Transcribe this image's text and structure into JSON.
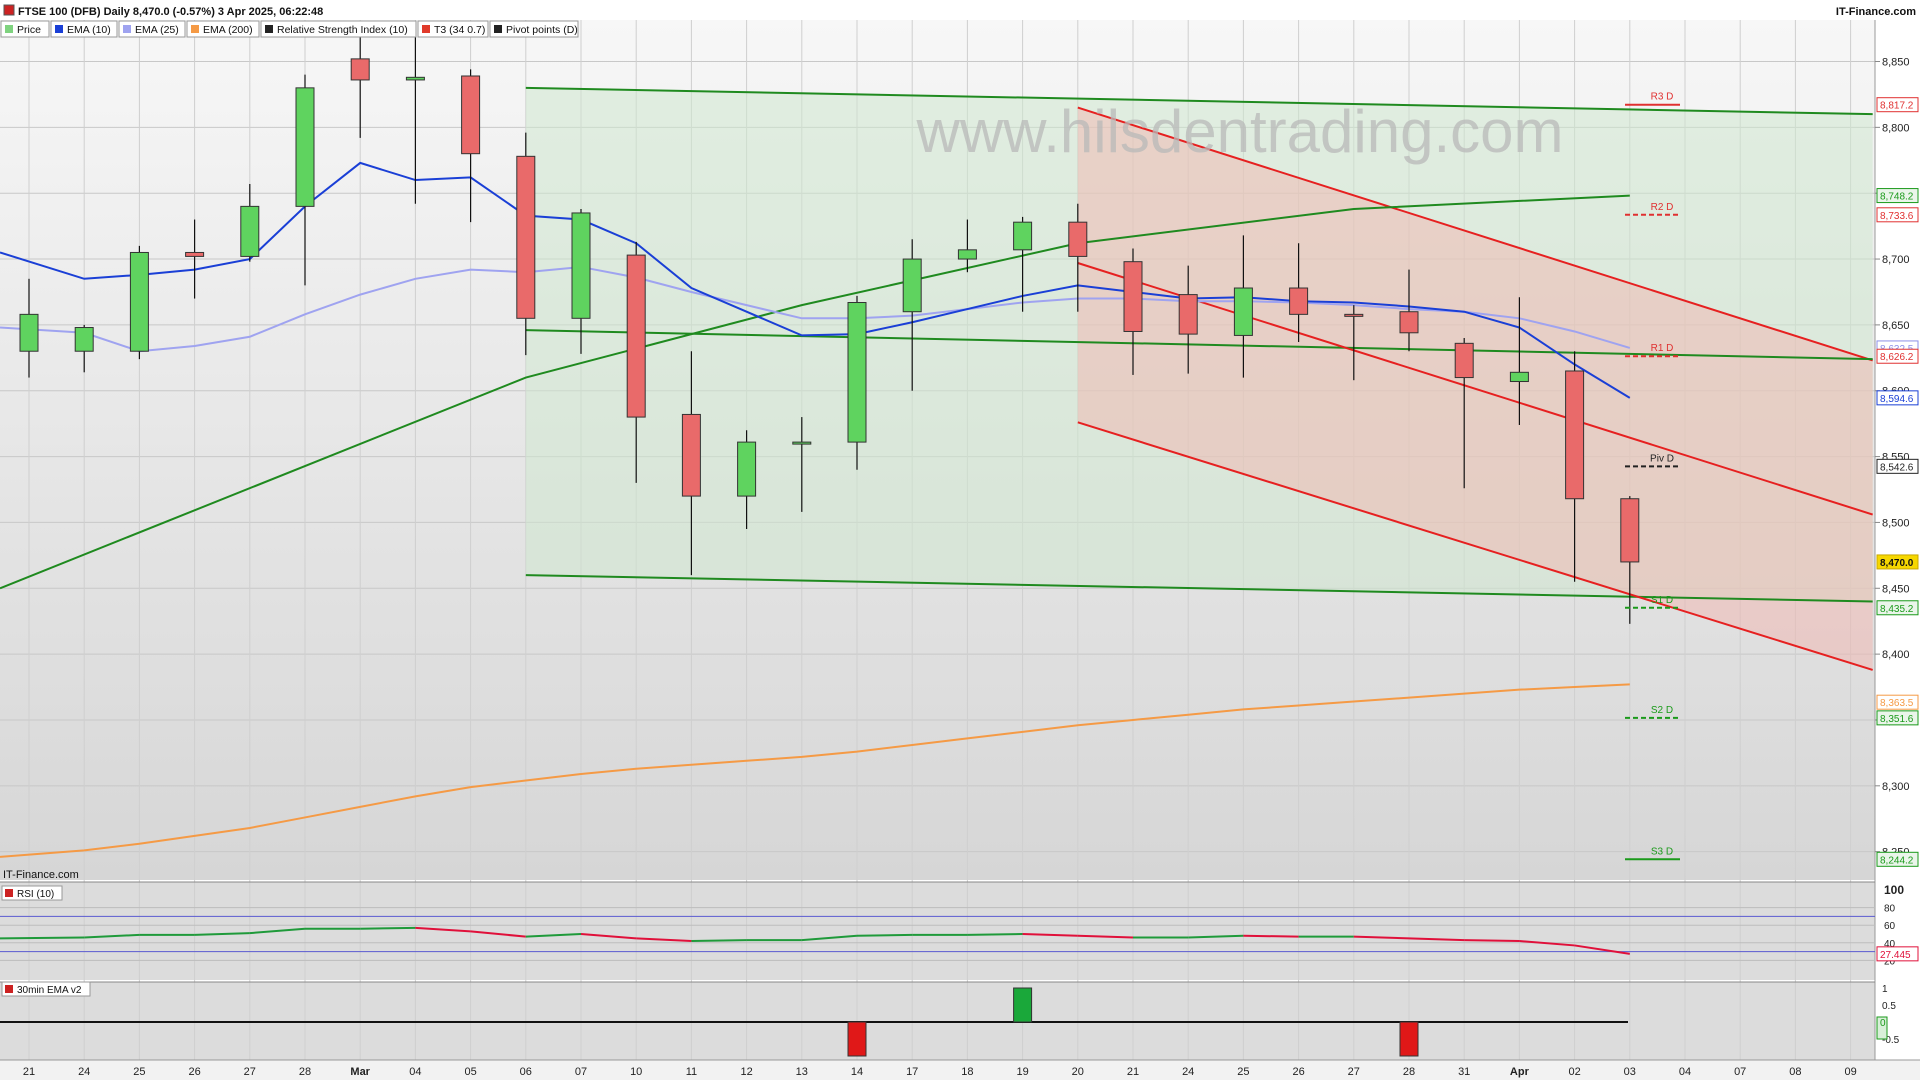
{
  "header": {
    "title": "FTSE 100 (DFB) Daily 8,470.0 (-0.57%) 3 Apr 2025, 06:22:48",
    "brand": "IT-Finance.com",
    "watermark": "www.hilsdentrading.com",
    "footer_brand": "IT-Finance.com"
  },
  "legend": [
    {
      "label": "Price",
      "color": "#7fd37f"
    },
    {
      "label": "EMA (10)",
      "color": "#1a3fd6"
    },
    {
      "label": "EMA (25)",
      "color": "#9fa3f0"
    },
    {
      "label": "EMA (200)",
      "color": "#f59a45"
    },
    {
      "label": "Relative Strength Index (10)",
      "color": "#222222"
    },
    {
      "label": "T3 (34 0.7)",
      "color": "#e03a2a"
    },
    {
      "label": "Pivot points (D)",
      "color": "#222222"
    }
  ],
  "rsi_panel": {
    "label": "RSI (10)",
    "value_label": "27.445"
  },
  "ema30_panel": {
    "label": "30min EMA v2"
  },
  "chart_data": {
    "type": "candlestick",
    "x_labels": [
      "21",
      "24",
      "25",
      "26",
      "27",
      "28",
      "Mar",
      "04",
      "05",
      "06",
      "07",
      "10",
      "11",
      "12",
      "13",
      "14",
      "17",
      "18",
      "19",
      "20",
      "21",
      "24",
      "25",
      "26",
      "27",
      "28",
      "31",
      "Apr",
      "02",
      "03",
      "04",
      "07",
      "08",
      "09"
    ],
    "candles": [
      {
        "o": 8630,
        "h": 8685,
        "l": 8610,
        "c": 8658
      },
      {
        "o": 8630,
        "h": 8650,
        "l": 8614,
        "c": 8648
      },
      {
        "o": 8630,
        "h": 8710,
        "l": 8624,
        "c": 8705
      },
      {
        "o": 8705,
        "h": 8730,
        "l": 8670,
        "c": 8702
      },
      {
        "o": 8702,
        "h": 8757,
        "l": 8698,
        "c": 8740
      },
      {
        "o": 8740,
        "h": 8840,
        "l": 8680,
        "c": 8830
      },
      {
        "o": 8852,
        "h": 8876,
        "l": 8792,
        "c": 8836
      },
      {
        "o": 8836,
        "h": 8871,
        "l": 8742,
        "c": 8838
      },
      {
        "o": 8839,
        "h": 8844,
        "l": 8728,
        "c": 8780
      },
      {
        "o": 8778,
        "h": 8796,
        "l": 8627,
        "c": 8655
      },
      {
        "o": 8655,
        "h": 8738,
        "l": 8628,
        "c": 8735
      },
      {
        "o": 8703,
        "h": 8713,
        "l": 8530,
        "c": 8580
      },
      {
        "o": 8582,
        "h": 8630,
        "l": 8460,
        "c": 8520
      },
      {
        "o": 8520,
        "h": 8570,
        "l": 8495,
        "c": 8561
      },
      {
        "o": 8561,
        "h": 8580,
        "l": 8508,
        "c": 8561
      },
      {
        "o": 8561,
        "h": 8672,
        "l": 8540,
        "c": 8667
      },
      {
        "o": 8660,
        "h": 8715,
        "l": 8600,
        "c": 8700
      },
      {
        "o": 8700,
        "h": 8730,
        "l": 8690,
        "c": 8707
      },
      {
        "o": 8707,
        "h": 8732,
        "l": 8660,
        "c": 8728
      },
      {
        "o": 8728,
        "h": 8742,
        "l": 8660,
        "c": 8702
      },
      {
        "o": 8698,
        "h": 8708,
        "l": 8612,
        "c": 8645
      },
      {
        "o": 8673,
        "h": 8695,
        "l": 8613,
        "c": 8643
      },
      {
        "o": 8642,
        "h": 8718,
        "l": 8610,
        "c": 8678
      },
      {
        "o": 8678,
        "h": 8712,
        "l": 8637,
        "c": 8658
      },
      {
        "o": 8658,
        "h": 8665,
        "l": 8608,
        "c": 8657
      },
      {
        "o": 8660,
        "h": 8692,
        "l": 8630,
        "c": 8644
      },
      {
        "o": 8636,
        "h": 8640,
        "l": 8526,
        "c": 8610
      },
      {
        "o": 8607,
        "h": 8671,
        "l": 8574,
        "c": 8614
      },
      {
        "o": 8615,
        "h": 8630,
        "l": 8455,
        "c": 8518
      },
      {
        "o": 8518,
        "h": 8520,
        "l": 8423,
        "c": 8470
      }
    ],
    "ema10": [
      8705,
      8685,
      8688,
      8692,
      8700,
      8740,
      8773,
      8760,
      8762,
      8733,
      8730,
      8712,
      8678,
      8660,
      8642,
      8643,
      8652,
      8662,
      8672,
      8680,
      8675,
      8670,
      8671,
      8668,
      8667,
      8664,
      8660,
      8648,
      8620,
      8594.6
    ],
    "ema25": [
      8648,
      8644,
      8630,
      8634,
      8641,
      8658,
      8673,
      8685,
      8692,
      8690,
      8694,
      8686,
      8675,
      8665,
      8655,
      8655,
      8657,
      8662,
      8667,
      8670,
      8670,
      8668,
      8668,
      8667,
      8665,
      8662,
      8660,
      8655,
      8645,
      8632.5
    ],
    "ema200": [
      8246,
      8251,
      8256,
      8262,
      8268,
      8276,
      8284,
      8292,
      8299,
      8304,
      8309,
      8313,
      8316,
      8319,
      8322,
      8326,
      8331,
      8336,
      8341,
      8346,
      8350,
      8354,
      8358,
      8361,
      8364,
      8367,
      8370,
      8373,
      8375,
      8377
    ],
    "pivots": [
      {
        "label": "R3 D",
        "value": 8817.2,
        "color": "#e03030"
      },
      {
        "label": "R2 D",
        "value": 8733.6,
        "color": "#e03030"
      },
      {
        "label": "R1 D",
        "value": 8626.2,
        "color": "#e03030"
      },
      {
        "label": "Piv D",
        "value": 8542.6,
        "color": "#222222"
      },
      {
        "label": "S1 D",
        "value": 8435.2,
        "color": "#1a9a1a"
      },
      {
        "label": "S2 D",
        "value": 8351.6,
        "color": "#1a9a1a"
      },
      {
        "label": "S3 D",
        "value": 8244.2,
        "color": "#1a9a1a"
      }
    ],
    "y_ticks": [
      "8,850",
      "8,800",
      "8,750",
      "8,700",
      "8,650",
      "8,600",
      "8,550",
      "8,500",
      "8,450",
      "8,400",
      "8,350",
      "8,300",
      "8,250"
    ],
    "y_tick_values": [
      8850,
      8800,
      8750,
      8700,
      8650,
      8600,
      8550,
      8500,
      8450,
      8400,
      8350,
      8300,
      8250
    ],
    "ylim": [
      8230,
      8880
    ],
    "right_labels": [
      {
        "text": "8,817.2",
        "value": 8817.2,
        "bg": "#ffffff",
        "fg": "#e03030",
        "border": "#e03030"
      },
      {
        "text": "8,748.2",
        "value": 8748.2,
        "bg": "#eaf5ea",
        "fg": "#1a9a1a",
        "border": "#1a9a1a"
      },
      {
        "text": "8,733.6",
        "value": 8733.6,
        "bg": "#ffffff",
        "fg": "#e03030",
        "border": "#e03030"
      },
      {
        "text": "8,632.5",
        "value": 8632.5,
        "bg": "#ffffff",
        "fg": "#8b8fe8",
        "border": "#8b8fe8"
      },
      {
        "text": "8,626.2",
        "value": 8626.2,
        "bg": "#ffffff",
        "fg": "#e03030",
        "border": "#e03030"
      },
      {
        "text": "8,594.6",
        "value": 8594.6,
        "bg": "#ffffff",
        "fg": "#1a3fd6",
        "border": "#1a3fd6"
      },
      {
        "text": "8,542.6",
        "value": 8542.6,
        "bg": "#ffffff",
        "fg": "#222222",
        "border": "#222222"
      },
      {
        "text": "8,470.0",
        "value": 8470.0,
        "bg": "#f6d700",
        "fg": "#111111",
        "border": "#c9a800"
      },
      {
        "text": "8,435.2",
        "value": 8435.2,
        "bg": "#eaf5ea",
        "fg": "#1a9a1a",
        "border": "#1a9a1a"
      },
      {
        "text": "8,363.5",
        "value": 8363.5,
        "bg": "#ffffff",
        "fg": "#f59a45",
        "border": "#f59a45"
      },
      {
        "text": "8,351.6",
        "value": 8351.6,
        "bg": "#eaf5ea",
        "fg": "#1a9a1a",
        "border": "#1a9a1a"
      },
      {
        "text": "8,244.2",
        "value": 8244.2,
        "bg": "#eaf5ea",
        "fg": "#1a9a1a",
        "border": "#1a9a1a"
      }
    ],
    "rsi": [
      45,
      46,
      49,
      49,
      51,
      56,
      56,
      57,
      53,
      47,
      50,
      45,
      42,
      43,
      43,
      48,
      49,
      49,
      50,
      48,
      46,
      46,
      48,
      47,
      47,
      45,
      43,
      42,
      37,
      27.445
    ],
    "rsi_ticks": [
      "100",
      "80",
      "60",
      "40",
      "20"
    ],
    "rsi_tick_values": [
      100,
      80,
      60,
      40,
      20
    ],
    "ema30_ticks": [
      "1",
      "0.5",
      "0",
      "-0.5"
    ],
    "ema30_tick_values": [
      1,
      0.5,
      0,
      -0.5
    ],
    "ema30_value_label": "0",
    "ema30_bars": [
      {
        "index": 15,
        "value": -1
      },
      {
        "index": 18,
        "value": 1
      },
      {
        "index": 25,
        "value": -1
      }
    ],
    "channels": {
      "green": {
        "start_index": 9,
        "upper": [
          8830,
          8810
        ],
        "middle": [
          8646,
          8624
        ],
        "lower": [
          8460,
          8440
        ],
        "end_index": 33.4
      },
      "red": {
        "start_index": 19,
        "upper": [
          8815,
          8623
        ],
        "middle": [
          8697,
          8506
        ],
        "lower": [
          8576,
          8388
        ],
        "end_index": 33.4
      },
      "t3": {
        "start": [
          0,
          8450
        ],
        "points": [
          [
            9,
            8610
          ],
          [
            14,
            8665
          ],
          [
            19,
            8712
          ],
          [
            24,
            8738
          ],
          [
            29,
            8748.2
          ]
        ]
      }
    }
  }
}
